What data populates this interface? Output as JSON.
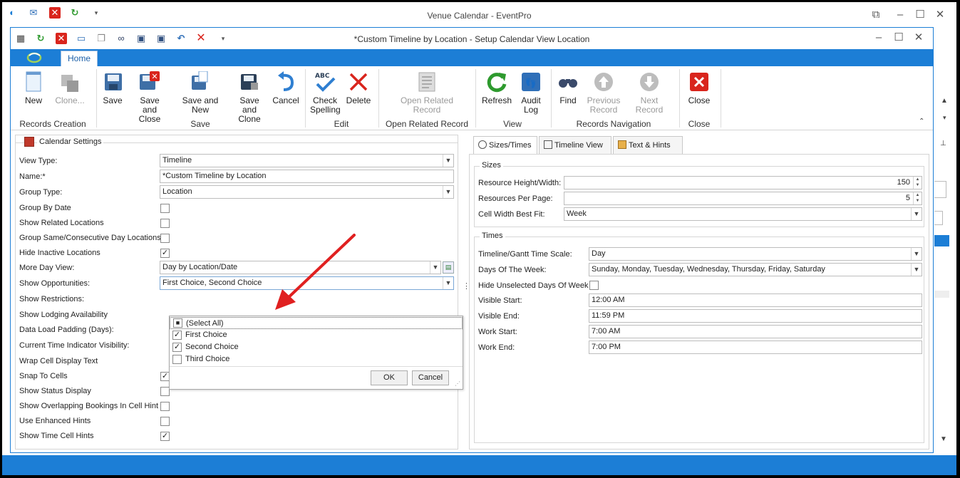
{
  "outer_window": {
    "title": "Venue Calendar - EventPro"
  },
  "inner_window": {
    "title": "*Custom Timeline by Location - Setup Calendar View Location"
  },
  "ribbon": {
    "tab_home": "Home",
    "groups": [
      {
        "label": "Records Creation",
        "buttons": [
          "New",
          "Clone..."
        ]
      },
      {
        "label": "Save",
        "buttons": [
          "Save",
          "Save and\nClose",
          "Save and New",
          "Save and\nClone",
          "Cancel"
        ]
      },
      {
        "label": "Edit",
        "buttons": [
          "Check\nSpelling",
          "Delete"
        ]
      },
      {
        "label": "Open Related Record",
        "buttons": [
          "Open Related\nRecord"
        ]
      },
      {
        "label": "View",
        "buttons": [
          "Refresh",
          "Audit\nLog"
        ]
      },
      {
        "label": "Records Navigation",
        "buttons": [
          "Find",
          "Previous\nRecord",
          "Next Record"
        ]
      },
      {
        "label": "Close",
        "buttons": [
          "Close"
        ]
      }
    ],
    "labels": {
      "new": "New",
      "clone": "Clone...",
      "save": "Save",
      "save_close_1": "Save and",
      "save_close_2": "Close",
      "save_new": "Save and New",
      "save_clone_1": "Save and",
      "save_clone_2": "Clone",
      "cancel": "Cancel",
      "check_1": "Check",
      "check_2": "Spelling",
      "delete": "Delete",
      "open_1": "Open Related",
      "open_2": "Record",
      "refresh": "Refresh",
      "audit_1": "Audit",
      "audit_2": "Log",
      "find": "Find",
      "prev_1": "Previous",
      "prev_2": "Record",
      "next": "Next Record",
      "close": "Close",
      "g_records": "Records Creation",
      "g_save": "Save",
      "g_edit": "Edit",
      "g_open": "Open Related Record",
      "g_view": "View",
      "g_nav": "Records Navigation",
      "g_close": "Close"
    }
  },
  "calendar_settings": {
    "title": "Calendar Settings",
    "view_type_label": "View Type:",
    "view_type_value": "Timeline",
    "name_label": "Name:*",
    "name_value": "*Custom Timeline by Location",
    "group_type_label": "Group Type:",
    "group_type_value": "Location",
    "group_by_date_label": "Group By Date",
    "show_related_label": "Show Related Locations",
    "group_same_label": "Group Same/Consecutive Day Locations",
    "hide_inactive_label": "Hide Inactive Locations",
    "more_day_view_label": "More Day View:",
    "more_day_view_value": "Day by Location/Date",
    "show_opps_label": "Show Opportunities:",
    "show_opps_value": "First Choice, Second Choice",
    "show_restrictions_label": "Show Restrictions:",
    "show_lodging_label": "Show Lodging Availability",
    "padding_label": "Data Load Padding (Days):",
    "current_time_label": "Current Time Indicator Visibility:",
    "wrap_label": "Wrap Cell Display Text",
    "snap_label": "Snap To Cells",
    "status_label": "Show Status Display",
    "overlap_label": "Show Overlapping Bookings In Cell Hint",
    "enhanced_label": "Use Enhanced Hints",
    "time_cell_label": "Show Time Cell Hints",
    "checks": {
      "group_by_date": false,
      "show_related": false,
      "group_same": false,
      "hide_inactive": true,
      "snap": true,
      "status": false,
      "overlap": false,
      "enhanced": false,
      "time_cell": true
    }
  },
  "popup": {
    "items": [
      "(Select All)",
      "First Choice",
      "Second Choice",
      "Third Choice"
    ],
    "checked": [
      false,
      true,
      true,
      false
    ],
    "ok": "OK",
    "cancel": "Cancel"
  },
  "right_tabs": {
    "sizes": "Sizes/Times",
    "timeline": "Timeline View",
    "text": "Text & Hints"
  },
  "sizes": {
    "title": "Sizes",
    "resource_label": "Resource Height/Width:",
    "resource_value": "150",
    "per_page_label": "Resources Per Page:",
    "per_page_value": "5",
    "cell_width_label": "Cell Width Best Fit:",
    "cell_width_value": "Week"
  },
  "times": {
    "title": "Times",
    "scale_label": "Timeline/Gantt Time Scale:",
    "scale_value": "Day",
    "dow_label": "Days Of The Week:",
    "dow_value": "Sunday, Monday, Tuesday, Wednesday, Thursday, Friday, Saturday",
    "hide_unselected_label": "Hide Unselected Days Of Week",
    "visible_start_label": "Visible Start:",
    "visible_start_value": "12:00 AM",
    "visible_end_label": "Visible End:",
    "visible_end_value": "11:59 PM",
    "work_start_label": "Work Start:",
    "work_start_value": "7:00 AM",
    "work_end_label": "Work End:",
    "work_end_value": "7:00 PM"
  },
  "colors": {
    "accent": "#1c7ed6",
    "arrow": "#e02020",
    "delete_red": "#d9251d",
    "refresh_green": "#2e9a2e"
  }
}
